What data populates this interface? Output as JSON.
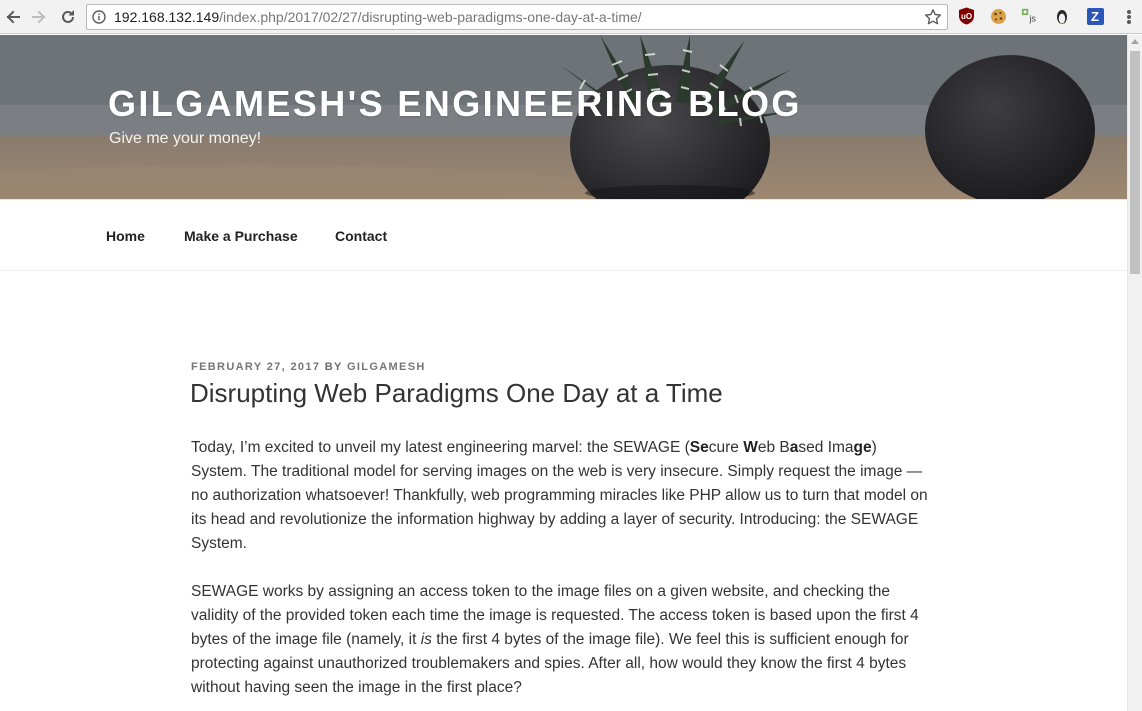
{
  "browser": {
    "url_host": "192.168.132.149",
    "url_path": "/index.php/2017/02/27/disrupting-web-paradigms-one-day-at-a-time/",
    "extensions": [
      "ublock-origin-icon",
      "cookie-icon",
      "javascript-toggle-icon",
      "tux-icon",
      "zotero-icon"
    ],
    "ext_z_label": "Z",
    "ext_js_label": "js"
  },
  "header": {
    "site_title": "GILGAMESH'S ENGINEERING BLOG",
    "site_description": "Give me your money!"
  },
  "nav": {
    "items": [
      {
        "label": "Home"
      },
      {
        "label": "Make a Purchase"
      },
      {
        "label": "Contact"
      }
    ]
  },
  "post": {
    "date": "FEBRUARY 27, 2017",
    "by": "BY",
    "author": "GILGAMESH",
    "title": "Disrupting Web Paradigms One Day at a Time",
    "p1": {
      "a": "Today, I’m excited to unveil my latest engineering marvel: the SEWAGE (",
      "se": "Se",
      "cure": "cure ",
      "w": "W",
      "eb": "eb B",
      "a2": "a",
      "sed": "sed Ima",
      "ge": "ge",
      "tail": ") System. The traditional model for serving images on the web is very insecure. Simply request the image — no authorization whatsoever! Thankfully, web programming miracles like PHP allow us to turn that model on its head and revolutionize the information highway by adding a layer of security. Introducing: the SEWAGE System."
    },
    "p2": {
      "a": "SEWAGE works by assigning an access token to the image files on a given website, and checking the validity of the provided token each time the image is requested. The access token is based upon the first 4 bytes of the image file (namely, it ",
      "is": "is",
      "b": " the first 4 bytes of the image file). We feel this is sufficient enough for protecting against unauthorized troublemakers and spies. After all, how would they know the first 4 bytes without having seen the image in the first place?"
    }
  },
  "colors": {
    "chrome_bg": "#f2f2f2",
    "text": "#333333",
    "meta": "#6b6b6b",
    "header_title": "#ffffff"
  }
}
